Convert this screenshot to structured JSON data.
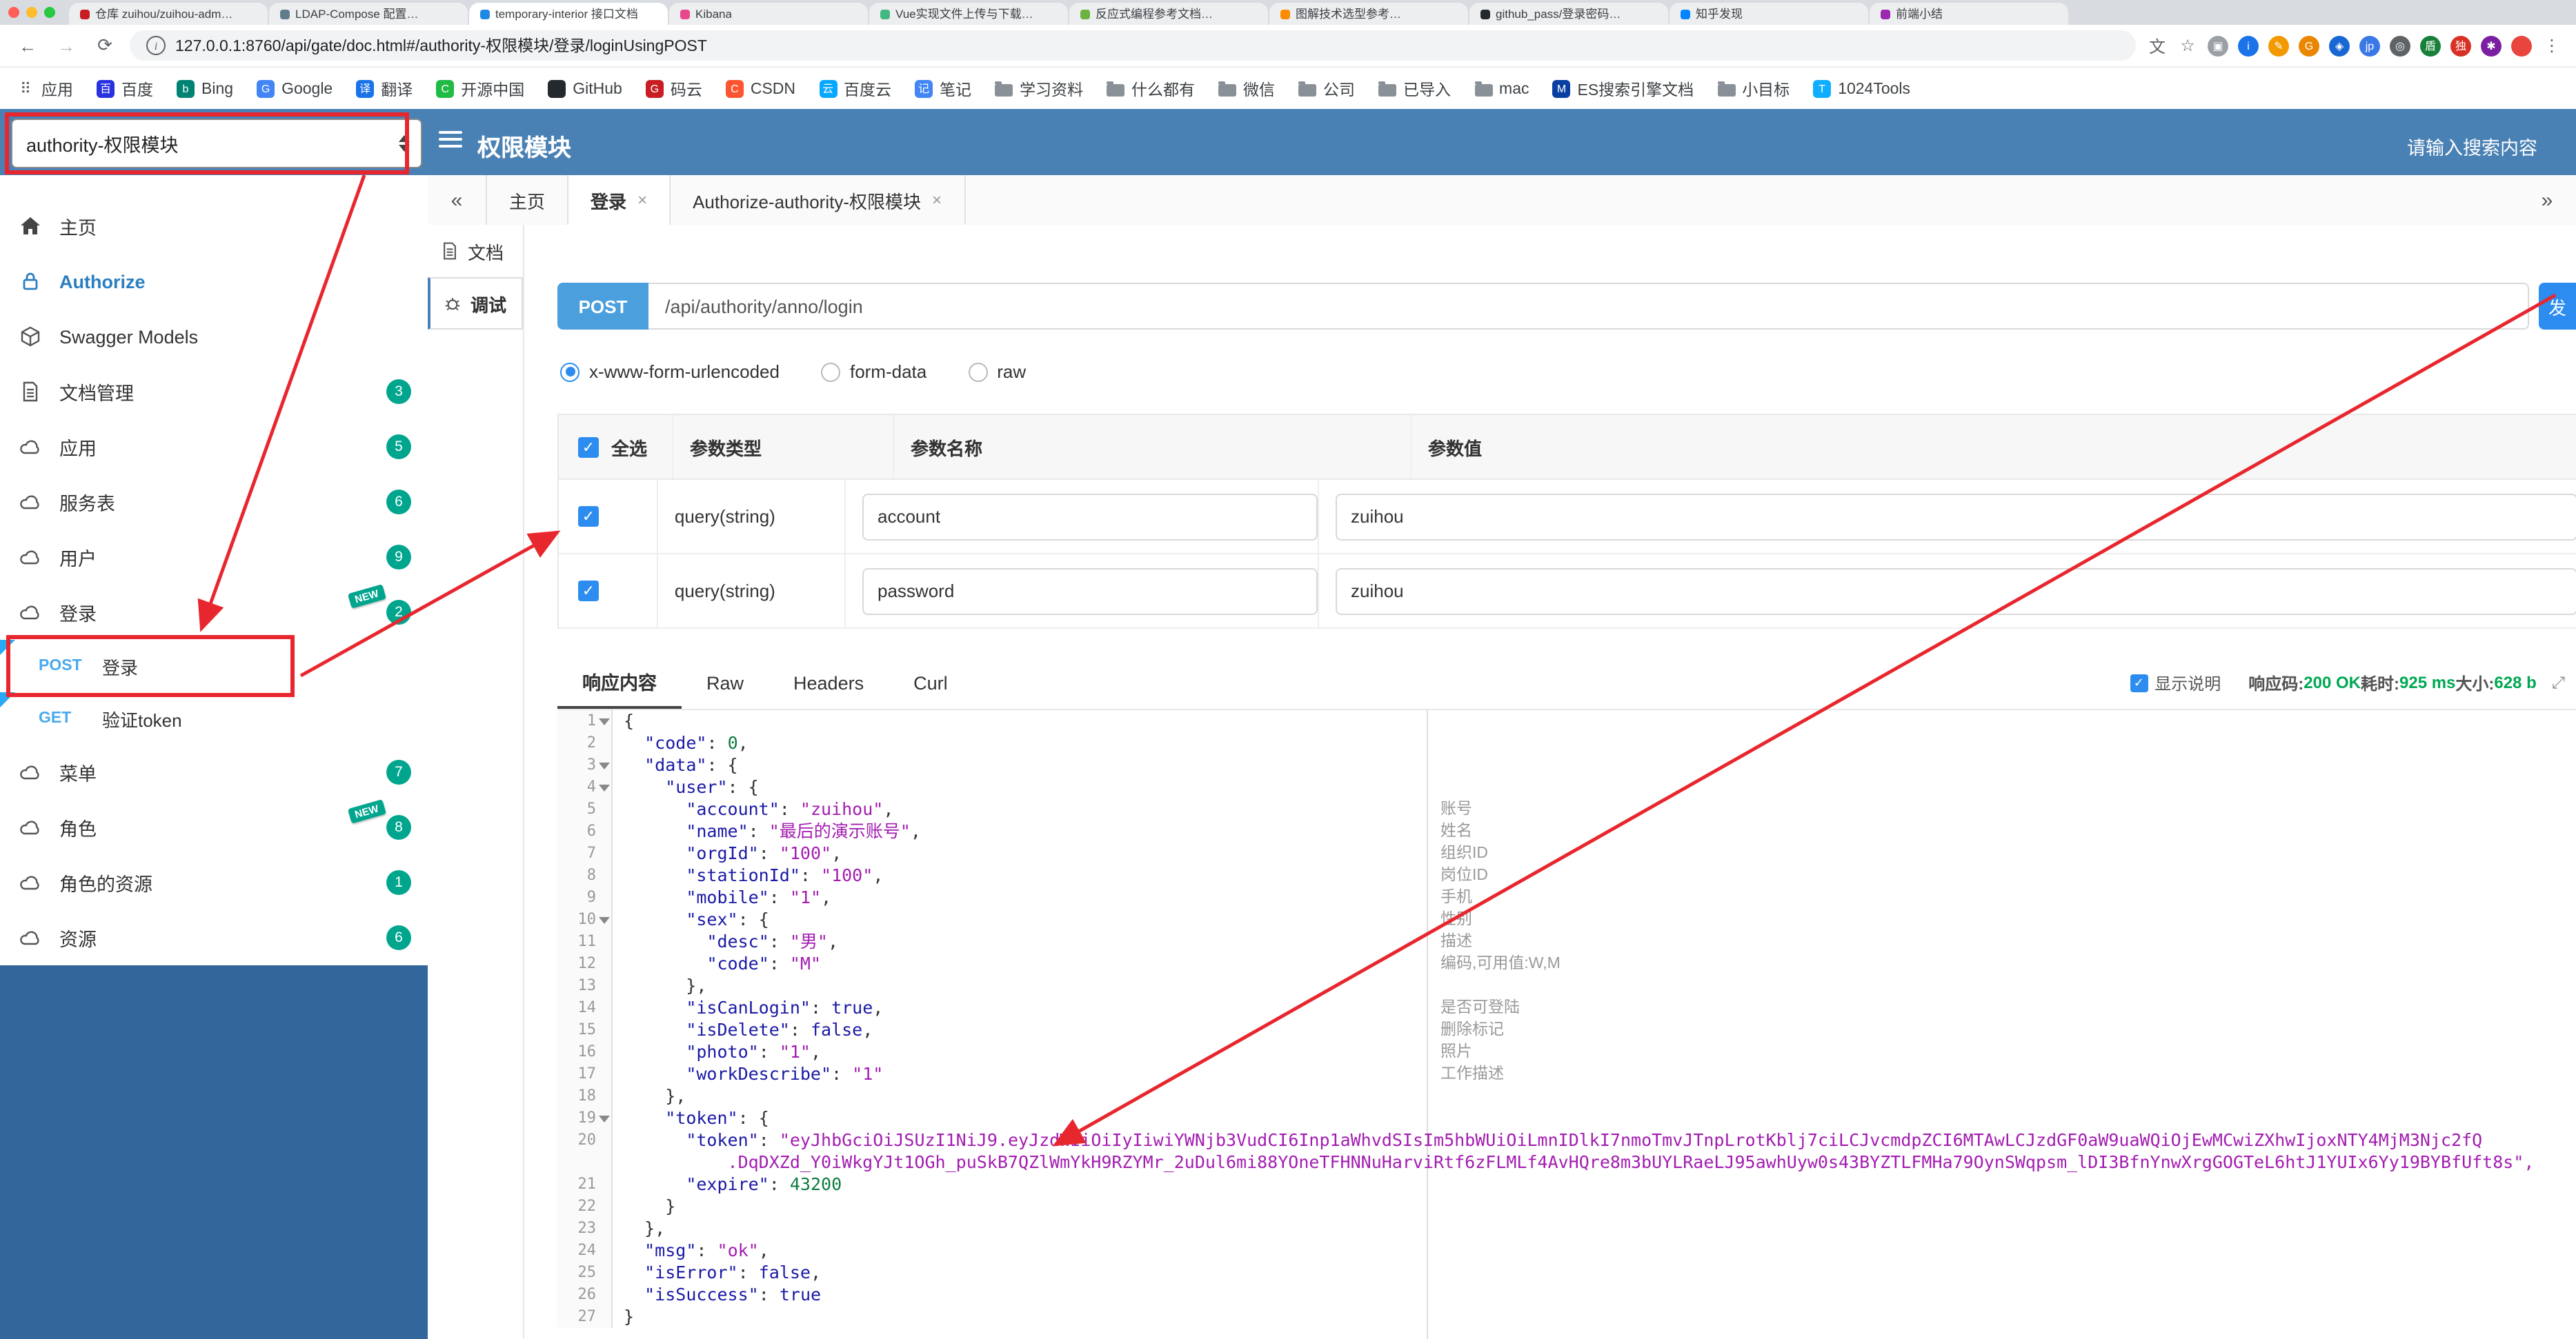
{
  "colors": {
    "header_blue": "#4a81b4",
    "sidebar_fill_blue": "#33669b",
    "accent_blue": "#2d8cf0",
    "method_blue": "#49a9ee",
    "badge_teal": "#00a58e",
    "annotation_red": "#e8262d",
    "success_green": "#00a854"
  },
  "browser": {
    "traffic_lights": [
      "#ff5f57",
      "#febc2e",
      "#28c840"
    ],
    "tabs": [
      {
        "label": "仓库 zuihou/zuihou-adm…",
        "color": "#c71d23"
      },
      {
        "label": "LDAP-Compose 配置…",
        "color": "#607d8b"
      },
      {
        "label": "temporary-interior 接口文档",
        "color": "#1e88e5"
      },
      {
        "label": "Kibana",
        "color": "#e8478b"
      },
      {
        "label": "Vue实现文件上传与下载…",
        "color": "#42b983"
      },
      {
        "label": "反应式编程参考文档…",
        "color": "#6db33f"
      },
      {
        "label": "图解技术选型参考…",
        "color": "#fb8c00"
      },
      {
        "label": "github_pass/登录密码…",
        "color": "#24292e"
      },
      {
        "label": "知乎发现",
        "color": "#0084ff"
      },
      {
        "label": "前端小结",
        "color": "#9c27b0"
      }
    ],
    "address": {
      "url": "127.0.0.1:8760/api/gate/doc.html#/authority-权限模块/登录/loginUsingPOST"
    },
    "ext_icons": [
      {
        "name": "translate-icon",
        "glyph": "文",
        "bg": ""
      },
      {
        "name": "bookmark-star-icon",
        "glyph": "☆",
        "bg": ""
      },
      {
        "name": "extension-icon-1",
        "glyph": "▣",
        "bg": "#9aa0a6"
      },
      {
        "name": "extension-icon-2",
        "glyph": "i",
        "bg": "#1a73e8"
      },
      {
        "name": "extension-icon-3",
        "glyph": "✎",
        "bg": "#f29900"
      },
      {
        "name": "extension-icon-4",
        "glyph": "G",
        "bg": "#ea8600"
      },
      {
        "name": "extension-icon-5",
        "glyph": "◈",
        "bg": "#1967d2"
      },
      {
        "name": "extension-icon-6",
        "glyph": "jp",
        "bg": "#3b78e7"
      },
      {
        "name": "extension-icon-7",
        "glyph": "◎",
        "bg": "#5f6368"
      },
      {
        "name": "extension-icon-8",
        "glyph": "盾",
        "bg": "#188038"
      },
      {
        "name": "extension-icon-9",
        "glyph": "独",
        "bg": "#d93025"
      },
      {
        "name": "extension-icon-10",
        "glyph": "✱",
        "bg": "#7b1fa2"
      },
      {
        "name": "avatar-icon",
        "glyph": "",
        "bg": "#e8453c"
      },
      {
        "name": "browser-menu-icon",
        "glyph": "⋮",
        "bg": ""
      }
    ],
    "bookmarks": [
      {
        "key": "apps",
        "label": "应用",
        "glyph": "⠿",
        "bg": ""
      },
      {
        "key": "baidu",
        "label": "百度",
        "glyph": "百",
        "bg": "#2932e1"
      },
      {
        "key": "bing",
        "label": "Bing",
        "glyph": "b",
        "bg": "#008373"
      },
      {
        "key": "google",
        "label": "Google",
        "glyph": "G",
        "bg": "#4285f4"
      },
      {
        "key": "translate",
        "label": "翻译",
        "glyph": "译",
        "bg": "#1a73e8"
      },
      {
        "key": "oschina",
        "label": "开源中国",
        "glyph": "C",
        "bg": "#21ba45"
      },
      {
        "key": "github",
        "label": "GitHub",
        "glyph": "",
        "bg": "#24292e"
      },
      {
        "key": "gitee",
        "label": "码云",
        "glyph": "G",
        "bg": "#c71d23"
      },
      {
        "key": "csdn",
        "label": "CSDN",
        "glyph": "C",
        "bg": "#fc5531"
      },
      {
        "key": "baidu-cloud",
        "label": "百度云",
        "glyph": "云",
        "bg": "#06a7ff"
      },
      {
        "key": "note",
        "label": "笔记",
        "glyph": "记",
        "bg": "#4285f4"
      },
      {
        "key": "study",
        "label": "学习资料",
        "folder": true
      },
      {
        "key": "misc",
        "label": "什么都有",
        "folder": true
      },
      {
        "key": "wechat",
        "label": "微信",
        "folder": true
      },
      {
        "key": "company",
        "label": "公司",
        "folder": true
      },
      {
        "key": "imported",
        "label": "已导入",
        "folder": true
      },
      {
        "key": "mac",
        "label": "mac",
        "folder": true
      },
      {
        "key": "es-doc",
        "label": "ES搜索引擎文档",
        "glyph": "M",
        "bg": "#083fa1"
      },
      {
        "key": "goal",
        "label": "小目标",
        "folder": true
      },
      {
        "key": "tools-1024",
        "label": "1024Tools",
        "glyph": "T",
        "bg": "#10aeff"
      }
    ]
  },
  "header": {
    "module_select": "authority-权限模块",
    "title": "权限模块",
    "search_placeholder": "请输入搜索内容"
  },
  "sidebar": {
    "items": [
      {
        "key": "home",
        "label": "主页",
        "icon": "home"
      },
      {
        "key": "authorize",
        "label": "Authorize",
        "icon": "lock",
        "accent": true
      },
      {
        "key": "swagger-models",
        "label": "Swagger Models",
        "icon": "cube"
      },
      {
        "key": "doc-manage",
        "label": "文档管理",
        "icon": "file",
        "badge": "3"
      },
      {
        "key": "app",
        "label": "应用",
        "icon": "cloud",
        "badge": "5"
      },
      {
        "key": "service",
        "label": "服务表",
        "icon": "cloud",
        "badge": "6"
      },
      {
        "key": "user",
        "label": "用户",
        "icon": "cloud",
        "badge": "9"
      },
      {
        "key": "login",
        "label": "登录",
        "icon": "cloud",
        "badge": "2",
        "tag": "NEW"
      },
      {
        "key": "op-login-post",
        "type": "operation",
        "method": "POST",
        "label": "登录",
        "marker": true
      },
      {
        "key": "op-token-get",
        "type": "operation",
        "method": "GET",
        "label": "验证token",
        "marker": true
      },
      {
        "key": "menu",
        "label": "菜单",
        "icon": "cloud",
        "badge": "7"
      },
      {
        "key": "role",
        "label": "角色",
        "icon": "cloud",
        "badge": "8",
        "tag": "NEW"
      },
      {
        "key": "role-resource",
        "label": "角色的资源",
        "icon": "cloud",
        "badge": "1"
      },
      {
        "key": "resource",
        "label": "资源",
        "icon": "cloud",
        "badge": "6"
      }
    ]
  },
  "doc_tabs": {
    "collapse_left": "«",
    "collapse_right": "»",
    "tabs": [
      {
        "label": "主页",
        "closable": false,
        "active": false
      },
      {
        "label": "登录",
        "closable": true,
        "active": true
      },
      {
        "label": "Authorize-authority-权限模块",
        "closable": true,
        "active": false
      }
    ]
  },
  "mini_nav": [
    {
      "key": "doc",
      "label": "文档",
      "active": false
    },
    {
      "key": "debug",
      "label": "调试",
      "active": true
    }
  ],
  "request": {
    "method": "POST",
    "url": "/api/authority/anno/login",
    "send_label": "发",
    "content_types": [
      {
        "label": "x-www-form-urlencoded",
        "selected": true
      },
      {
        "label": "form-data",
        "selected": false
      },
      {
        "label": "raw",
        "selected": false
      }
    ]
  },
  "table": {
    "select_all_label": "全选",
    "headers": {
      "type": "参数类型",
      "name": "参数名称",
      "value": "参数值"
    },
    "rows": [
      {
        "checked": true,
        "type": "query(string)",
        "name": "account",
        "value": "zuihou"
      },
      {
        "checked": true,
        "type": "query(string)",
        "name": "password",
        "value": "zuihou"
      }
    ]
  },
  "response": {
    "tabs": [
      {
        "label": "响应内容",
        "active": true
      },
      {
        "label": "Raw",
        "active": false
      },
      {
        "label": "Headers",
        "active": false
      },
      {
        "label": "Curl",
        "active": false
      }
    ],
    "show_desc_label": "显示说明",
    "show_desc_checked": true,
    "meta": [
      {
        "label": "响应码:",
        "value": "200 OK"
      },
      {
        "label": "耗时:",
        "value": "925 ms"
      },
      {
        "label": "大小:",
        "value": "628 b"
      }
    ]
  },
  "code": {
    "lines": [
      {
        "n": "1",
        "fold": true,
        "seg": [
          [
            "pl",
            "{"
          ]
        ]
      },
      {
        "n": "2",
        "seg": [
          [
            "pl",
            "  "
          ],
          [
            "key",
            "\"code\""
          ],
          [
            "pl",
            ": "
          ],
          [
            "num",
            "0"
          ],
          [
            "pl",
            ","
          ]
        ]
      },
      {
        "n": "3",
        "fold": true,
        "seg": [
          [
            "pl",
            "  "
          ],
          [
            "key",
            "\"data\""
          ],
          [
            "pl",
            ": {"
          ]
        ]
      },
      {
        "n": "4",
        "fold": true,
        "seg": [
          [
            "pl",
            "    "
          ],
          [
            "key",
            "\"user\""
          ],
          [
            "pl",
            ": {"
          ]
        ]
      },
      {
        "n": "5",
        "seg": [
          [
            "pl",
            "      "
          ],
          [
            "key",
            "\"account\""
          ],
          [
            "pl",
            ": "
          ],
          [
            "str",
            "\"zuihou\""
          ],
          [
            "pl",
            ","
          ]
        ]
      },
      {
        "n": "6",
        "seg": [
          [
            "pl",
            "      "
          ],
          [
            "key",
            "\"name\""
          ],
          [
            "pl",
            ": "
          ],
          [
            "str",
            "\"最后的演示账号\""
          ],
          [
            "pl",
            ","
          ]
        ]
      },
      {
        "n": "7",
        "seg": [
          [
            "pl",
            "      "
          ],
          [
            "key",
            "\"orgId\""
          ],
          [
            "pl",
            ": "
          ],
          [
            "str",
            "\"100\""
          ],
          [
            "pl",
            ","
          ]
        ]
      },
      {
        "n": "8",
        "seg": [
          [
            "pl",
            "      "
          ],
          [
            "key",
            "\"stationId\""
          ],
          [
            "pl",
            ": "
          ],
          [
            "str",
            "\"100\""
          ],
          [
            "pl",
            ","
          ]
        ]
      },
      {
        "n": "9",
        "seg": [
          [
            "pl",
            "      "
          ],
          [
            "key",
            "\"mobile\""
          ],
          [
            "pl",
            ": "
          ],
          [
            "str",
            "\"1\""
          ],
          [
            "pl",
            ","
          ]
        ]
      },
      {
        "n": "10",
        "fold": true,
        "seg": [
          [
            "pl",
            "      "
          ],
          [
            "key",
            "\"sex\""
          ],
          [
            "pl",
            ": {"
          ]
        ]
      },
      {
        "n": "11",
        "seg": [
          [
            "pl",
            "        "
          ],
          [
            "key",
            "\"desc\""
          ],
          [
            "pl",
            ": "
          ],
          [
            "str",
            "\"男\""
          ],
          [
            "pl",
            ","
          ]
        ]
      },
      {
        "n": "12",
        "seg": [
          [
            "pl",
            "        "
          ],
          [
            "key",
            "\"code\""
          ],
          [
            "pl",
            ": "
          ],
          [
            "str",
            "\"M\""
          ]
        ]
      },
      {
        "n": "13",
        "seg": [
          [
            "pl",
            "      },"
          ]
        ]
      },
      {
        "n": "14",
        "seg": [
          [
            "pl",
            "      "
          ],
          [
            "key",
            "\"isCanLogin\""
          ],
          [
            "pl",
            ": "
          ],
          [
            "bool",
            "true"
          ],
          [
            "pl",
            ","
          ]
        ]
      },
      {
        "n": "15",
        "seg": [
          [
            "pl",
            "      "
          ],
          [
            "key",
            "\"isDelete\""
          ],
          [
            "pl",
            ": "
          ],
          [
            "bool",
            "false"
          ],
          [
            "pl",
            ","
          ]
        ]
      },
      {
        "n": "16",
        "seg": [
          [
            "pl",
            "      "
          ],
          [
            "key",
            "\"photo\""
          ],
          [
            "pl",
            ": "
          ],
          [
            "str",
            "\"1\""
          ],
          [
            "pl",
            ","
          ]
        ]
      },
      {
        "n": "17",
        "seg": [
          [
            "pl",
            "      "
          ],
          [
            "key",
            "\"workDescribe\""
          ],
          [
            "pl",
            ": "
          ],
          [
            "str",
            "\"1\""
          ]
        ]
      },
      {
        "n": "18",
        "seg": [
          [
            "pl",
            "    },"
          ]
        ]
      },
      {
        "n": "19",
        "fold": true,
        "seg": [
          [
            "pl",
            "    "
          ],
          [
            "key",
            "\"token\""
          ],
          [
            "pl",
            ": {"
          ]
        ]
      },
      {
        "n": "20",
        "seg": [
          [
            "pl",
            "      "
          ],
          [
            "key",
            "\"token\""
          ],
          [
            "pl",
            ": "
          ],
          [
            "str",
            "\"eyJhbGciOiJSUzI1NiJ9.eyJzdWIiOiIyIiwiYWNjb3VudCI6Inp1aWhvdSIsIm5hbWUiOiLmnIDlkI7nmoTmvJTnpLrotKblj7ciLCJvcmdpZCI6MTAwLCJzdGF0aW9uaWQiOjEwMCwiZXhwIjoxNTY4MjM3Njc2fQ"
          ]
        ]
      },
      {
        "n": "",
        "seg": [
          [
            "str",
            "          .DqDXZd_Y0iWkgYJt1OGh_puSkB7QZlWmYkH9RZYMr_2uDul6mi88YOneTFHNNuHarviRtf6zFLMLf4AvHQre8m3bUYLRaeLJ95awhUyw0s43BYZTLFMHa79OynSWqpsm_lDI3BfnYnwXrgGOGTeL6htJ1YUIx6Yy19BYBfUft8s\","
          ]
        ]
      },
      {
        "n": "21",
        "seg": [
          [
            "pl",
            "      "
          ],
          [
            "key",
            "\"expire\""
          ],
          [
            "pl",
            ": "
          ],
          [
            "num",
            "43200"
          ]
        ]
      },
      {
        "n": "22",
        "seg": [
          [
            "pl",
            "    }"
          ]
        ]
      },
      {
        "n": "23",
        "seg": [
          [
            "pl",
            "  },"
          ]
        ]
      },
      {
        "n": "24",
        "seg": [
          [
            "pl",
            "  "
          ],
          [
            "key",
            "\"msg\""
          ],
          [
            "pl",
            ": "
          ],
          [
            "str",
            "\"ok\""
          ],
          [
            "pl",
            ","
          ]
        ]
      },
      {
        "n": "25",
        "seg": [
          [
            "pl",
            "  "
          ],
          [
            "key",
            "\"isError\""
          ],
          [
            "pl",
            ": "
          ],
          [
            "bool",
            "false"
          ],
          [
            "pl",
            ","
          ]
        ]
      },
      {
        "n": "26",
        "seg": [
          [
            "pl",
            "  "
          ],
          [
            "key",
            "\"isSuccess\""
          ],
          [
            "pl",
            ": "
          ],
          [
            "bool",
            "true"
          ]
        ]
      },
      {
        "n": "27",
        "seg": [
          [
            "pl",
            "}"
          ]
        ]
      }
    ],
    "annotations": [
      {
        "line": 5,
        "text": "账号"
      },
      {
        "line": 6,
        "text": "姓名"
      },
      {
        "line": 7,
        "text": "组织ID"
      },
      {
        "line": 8,
        "text": "岗位ID"
      },
      {
        "line": 9,
        "text": "手机"
      },
      {
        "line": 10,
        "text": "性别"
      },
      {
        "line": 11,
        "text": "描述"
      },
      {
        "line": 12,
        "text": "编码,可用值:W,M"
      },
      {
        "line": 14,
        "text": "是否可登陆"
      },
      {
        "line": 15,
        "text": "删除标记"
      },
      {
        "line": 16,
        "text": "照片"
      },
      {
        "line": 17,
        "text": "工作描述"
      }
    ]
  }
}
